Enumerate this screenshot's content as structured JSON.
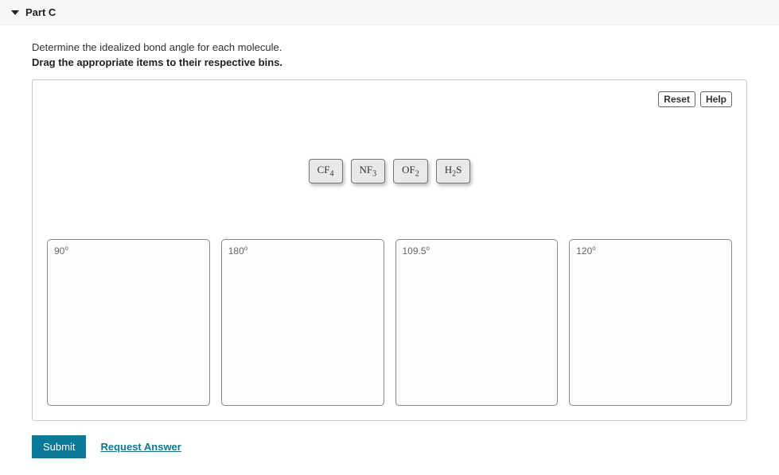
{
  "header": {
    "title": "Part C"
  },
  "prompt": "Determine the idealized bond angle for each molecule.",
  "instruction": "Drag the appropriate items to their respective bins.",
  "toolbar": {
    "reset": "Reset",
    "help": "Help"
  },
  "items": [
    {
      "base": "CF",
      "sub": "4"
    },
    {
      "base": "NF",
      "sub": "3"
    },
    {
      "base": "OF",
      "sub": "2"
    },
    {
      "base": "H",
      "sub": "2",
      "tail": "S"
    }
  ],
  "bins": [
    {
      "value": "90",
      "unit": "o"
    },
    {
      "value": "180",
      "unit": "o"
    },
    {
      "value": "109.5",
      "unit": "o"
    },
    {
      "value": "120",
      "unit": "o"
    }
  ],
  "actions": {
    "submit": "Submit",
    "request": "Request Answer"
  }
}
